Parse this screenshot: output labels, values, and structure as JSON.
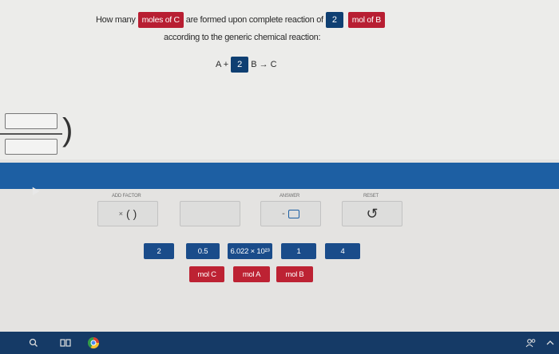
{
  "question": {
    "prefix": "How many",
    "tag_unknown": "moles of C",
    "middle": "are formed upon complete reaction of",
    "given_amount": "2",
    "given_unit": "mol of B",
    "line2": "according to the generic chemical reaction:",
    "reaction_a": "A +",
    "coefficient": "2",
    "reaction_rest": "B → C"
  },
  "toolbar": {
    "add_factor_label": "ADD FACTOR",
    "add_factor_x": "×",
    "add_factor_parens": "( )",
    "answer_label": "ANSWER",
    "answer_minus": "-",
    "reset_label": "RESET",
    "reset_icon": "↺"
  },
  "number_tiles": [
    "2",
    "0.5",
    "6.022 × 10²³",
    "1",
    "4"
  ],
  "unit_tiles": [
    "mol C",
    "mol A",
    "mol B"
  ],
  "colors": {
    "red": "#bd2233",
    "navy": "#1a4c8a",
    "blue_bar": "#1d5fa3"
  }
}
